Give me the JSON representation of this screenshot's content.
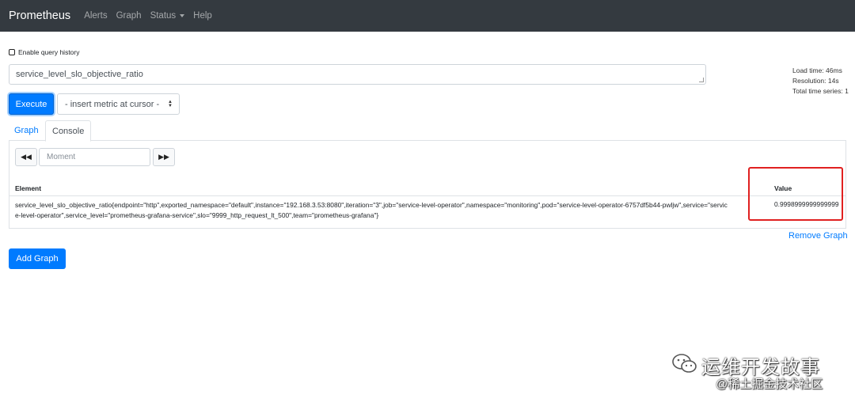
{
  "navbar": {
    "brand": "Prometheus",
    "items": [
      "Alerts",
      "Graph",
      "Status",
      "Help"
    ]
  },
  "history": {
    "label": "Enable query history",
    "checked": false
  },
  "query": {
    "value": "service_level_slo_objective_ratio"
  },
  "stats": {
    "load_time": "Load time: 46ms",
    "resolution": "Resolution: 14s",
    "total_series": "Total time series: 1"
  },
  "buttons": {
    "execute": "Execute",
    "insert_metric": "- insert metric at cursor -",
    "remove_graph": "Remove Graph",
    "add_graph": "Add Graph"
  },
  "tabs": [
    "Graph",
    "Console"
  ],
  "active_tab": "Console",
  "console": {
    "moment_placeholder": "Moment",
    "back_icon": "double-arrow-left-icon",
    "forward_icon": "double-arrow-right-icon",
    "columns": [
      "Element",
      "Value"
    ],
    "rows": [
      {
        "element": "service_level_slo_objective_ratio{endpoint=\"http\",exported_namespace=\"default\",instance=\"192.168.3.53:8080\",iteration=\"3\",job=\"service-level-operator\",namespace=\"monitoring\",pod=\"service-level-operator-6757df5b44-pwljw\",service=\"service-level-operator\",service_level=\"prometheus-grafana-service\",slo=\"9999_http_request_lt_500\",team=\"prometheus-grafana\"}",
        "value": "0.9998999999999999"
      }
    ]
  },
  "watermark": {
    "title": "运维开发故事",
    "subtitle": "@稀土掘金技术社区",
    "icon": "wechat-icon"
  },
  "colors": {
    "navbar": "#343a40",
    "primary": "#007bff",
    "highlight": "#e02020"
  }
}
